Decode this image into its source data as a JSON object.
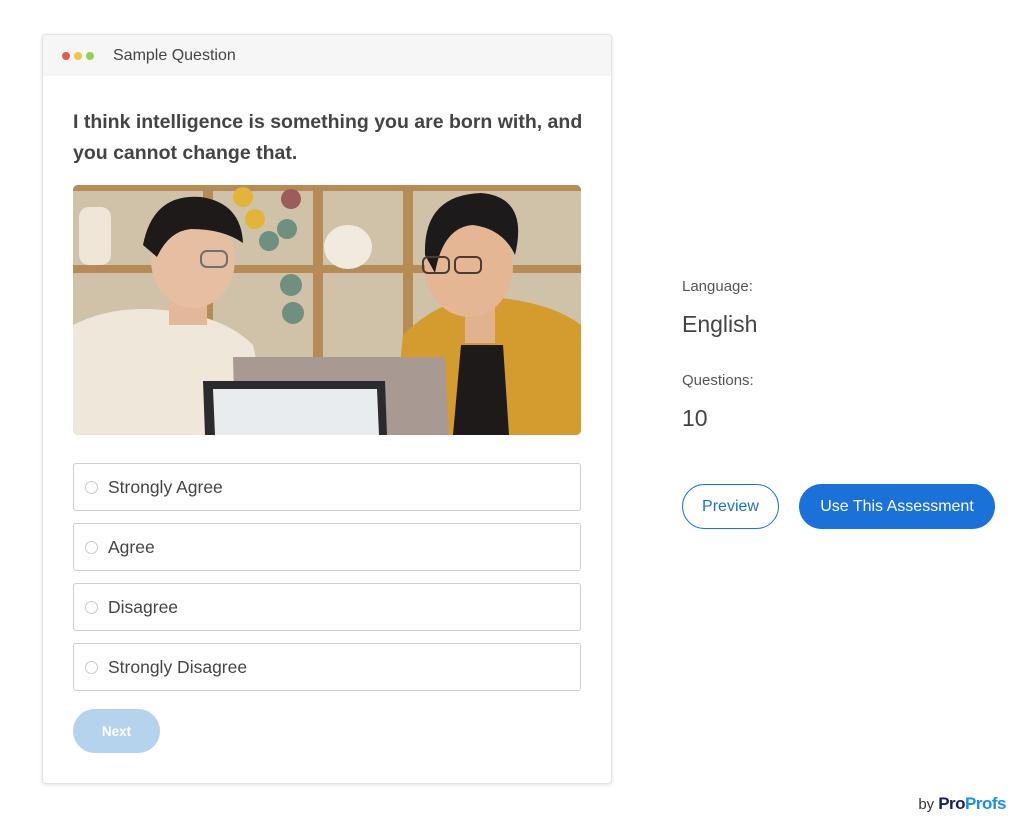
{
  "card": {
    "title": "Sample Question",
    "question": "I think intelligence is something you are born with, and you cannot change that.",
    "options": [
      {
        "label": "Strongly Agree"
      },
      {
        "label": "Agree"
      },
      {
        "label": "Disagree"
      },
      {
        "label": "Strongly Disagree"
      }
    ],
    "next_label": "Next"
  },
  "meta": {
    "language_label": "Language:",
    "language_value": "English",
    "questions_label": "Questions:",
    "questions_value": "10"
  },
  "actions": {
    "preview_label": "Preview",
    "use_label": "Use This Assessment"
  },
  "footer": {
    "by": "by",
    "brand_pro": "Pro",
    "brand_profs": "Profs"
  },
  "colors": {
    "accent": "#1a72d8",
    "next_disabled": "#b5d3ec",
    "dot_red": "#e25b4c",
    "dot_yellow": "#f3c53c",
    "dot_green": "#8fd15b"
  }
}
